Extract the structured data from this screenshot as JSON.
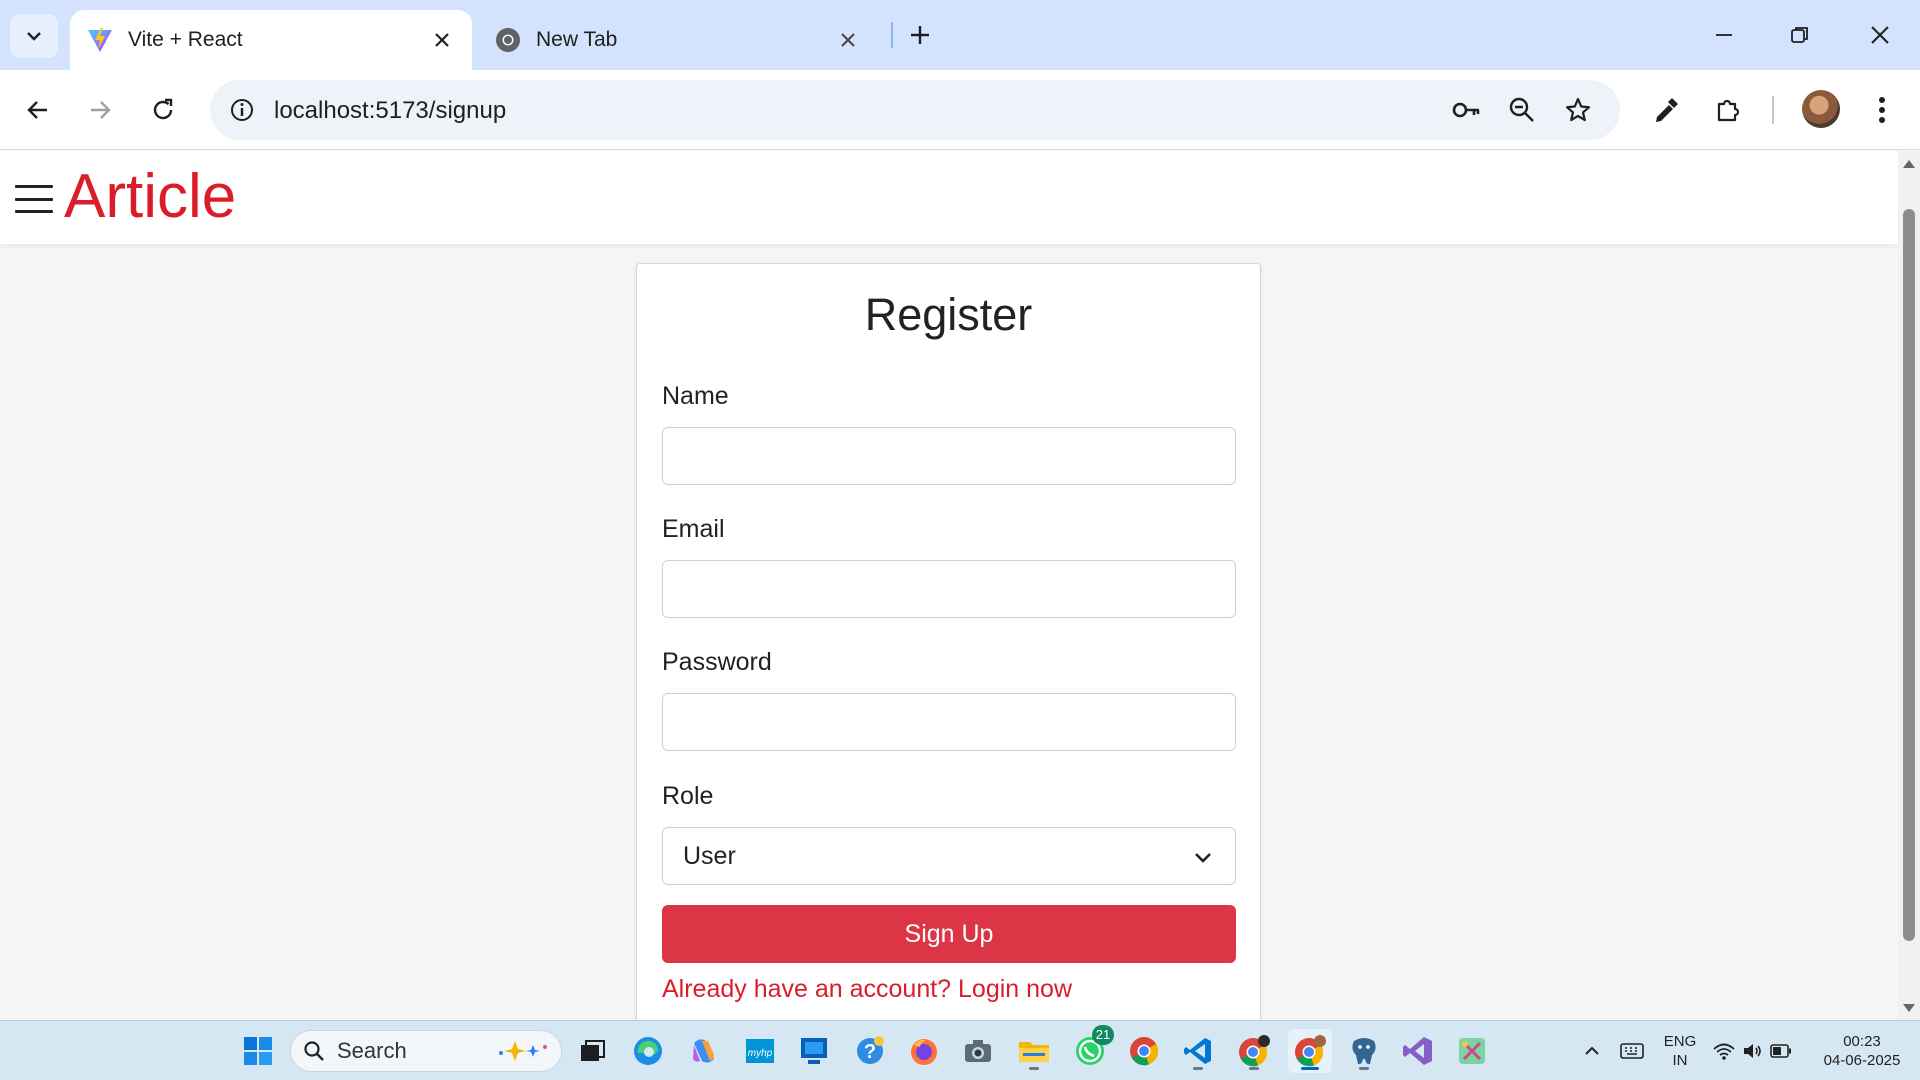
{
  "browser": {
    "tabs": [
      {
        "title": "Vite + React",
        "active": true,
        "icon": "vite-icon"
      },
      {
        "title": "New Tab",
        "active": false,
        "icon": "chrome-icon"
      }
    ],
    "url": "localhost:5173/signup"
  },
  "site": {
    "brand": "Article"
  },
  "form": {
    "title": "Register",
    "name_label": "Name",
    "name_value": "",
    "email_label": "Email",
    "email_value": "",
    "password_label": "Password",
    "password_value": "",
    "role_label": "Role",
    "role_value": "User",
    "submit_label": "Sign Up",
    "login_link": "Already have an account? Login now"
  },
  "colors": {
    "brand_red": "#d91e2a",
    "button_red": "#dc3545",
    "tabbar": "#d3e3fd"
  },
  "taskbar": {
    "search_label": "Search",
    "whatsapp_badge": "21",
    "language_line1": "ENG",
    "language_line2": "IN",
    "time": "00:23",
    "date": "04-06-2025"
  }
}
